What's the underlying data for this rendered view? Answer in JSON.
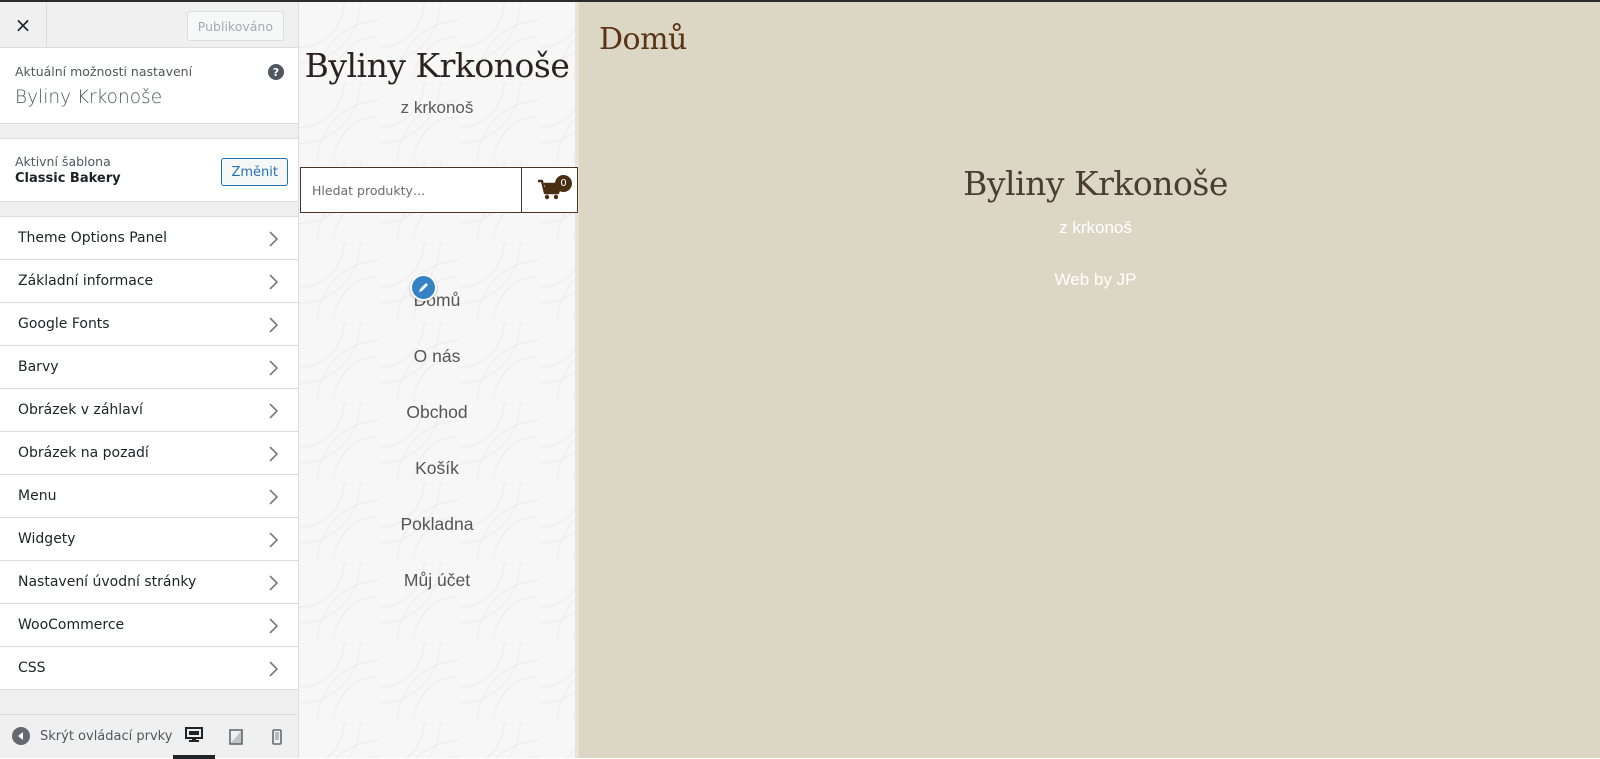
{
  "header": {
    "close_label": "×",
    "publish_label": "Publikováno"
  },
  "info": {
    "label": "Aktuální možnosti nastavení",
    "site_name": "Byliny Krkonoše",
    "help_label": "?"
  },
  "theme": {
    "label": "Aktivní šablona",
    "name": "Classic Bakery",
    "change_label": "Změnit"
  },
  "menu": {
    "items": [
      {
        "label": "Theme Options Panel"
      },
      {
        "label": "Základní informace"
      },
      {
        "label": "Google Fonts"
      },
      {
        "label": "Barvy"
      },
      {
        "label": "Obrázek v záhlaví"
      },
      {
        "label": "Obrázek na pozadí"
      },
      {
        "label": "Menu"
      },
      {
        "label": "Widgety"
      },
      {
        "label": "Nastavení úvodní stránky"
      },
      {
        "label": "WooCommerce"
      },
      {
        "label": "CSS"
      }
    ]
  },
  "footer_controls": {
    "collapse_label": "Skrýt ovládací prvky",
    "devices": [
      "desktop-icon",
      "tablet-icon",
      "mobile-icon"
    ]
  },
  "site": {
    "title": "Byliny Krkonoše",
    "tagline": "z krkonoš",
    "search_placeholder": "Hledat produkty…",
    "cart_count": "0",
    "nav": [
      {
        "label": "Domů"
      },
      {
        "label": "O nás"
      },
      {
        "label": "Obchod"
      },
      {
        "label": "Košík"
      },
      {
        "label": "Pokladna"
      },
      {
        "label": "Můj účet"
      }
    ],
    "page_title": "Domů",
    "footer_title": "Byliny Krkonoše",
    "footer_tagline": "z krkonoš",
    "footer_credit": "Web by JP"
  },
  "colors": {
    "accent": "#2271b1",
    "preview_bg": "#dcd6c4",
    "brand_brown": "#5a3414",
    "edit_pencil": "#3582c4"
  }
}
